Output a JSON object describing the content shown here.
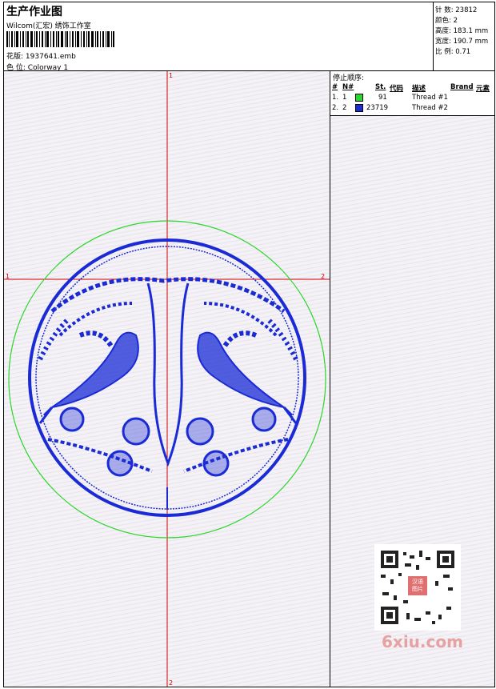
{
  "header": {
    "title": "生产作业图",
    "company": "Wilcom(汇宏) 绣饰工作室",
    "design_label": "花版:",
    "design_value": "1937641.emb",
    "colorway_label": "色 位:",
    "colorway_value": "Colorway 1"
  },
  "stats": {
    "stitches": "针 数: 23812",
    "colors": "颜色: 2",
    "height": "高度: 183.1 mm",
    "width": "宽度: 190.7 mm",
    "scale": "比 例: 0.71"
  },
  "stop_sequence": {
    "title": "停止顺序:",
    "columns": {
      "hash": "#",
      "n": "N#",
      "st": "St.",
      "code": "代码",
      "desc": "描述",
      "brand": "Brand",
      "element": "元素"
    },
    "rows": [
      {
        "idx": "1.",
        "n": "1",
        "color": "#2bd62b",
        "code": "91",
        "desc": "Thread #1"
      },
      {
        "idx": "2.",
        "n": "2",
        "color": "#1a2bd6",
        "code": "23719",
        "desc": "Thread #2"
      }
    ]
  },
  "axes": {
    "top": "1",
    "bottom": "2",
    "left": "1",
    "right": "2"
  },
  "watermark": "6xiu.com",
  "qr_label": "汉语图片",
  "colors": {
    "outline_green": "#2bd62b",
    "design_blue": "#1a2bd6",
    "crosshair": "#d00000"
  }
}
